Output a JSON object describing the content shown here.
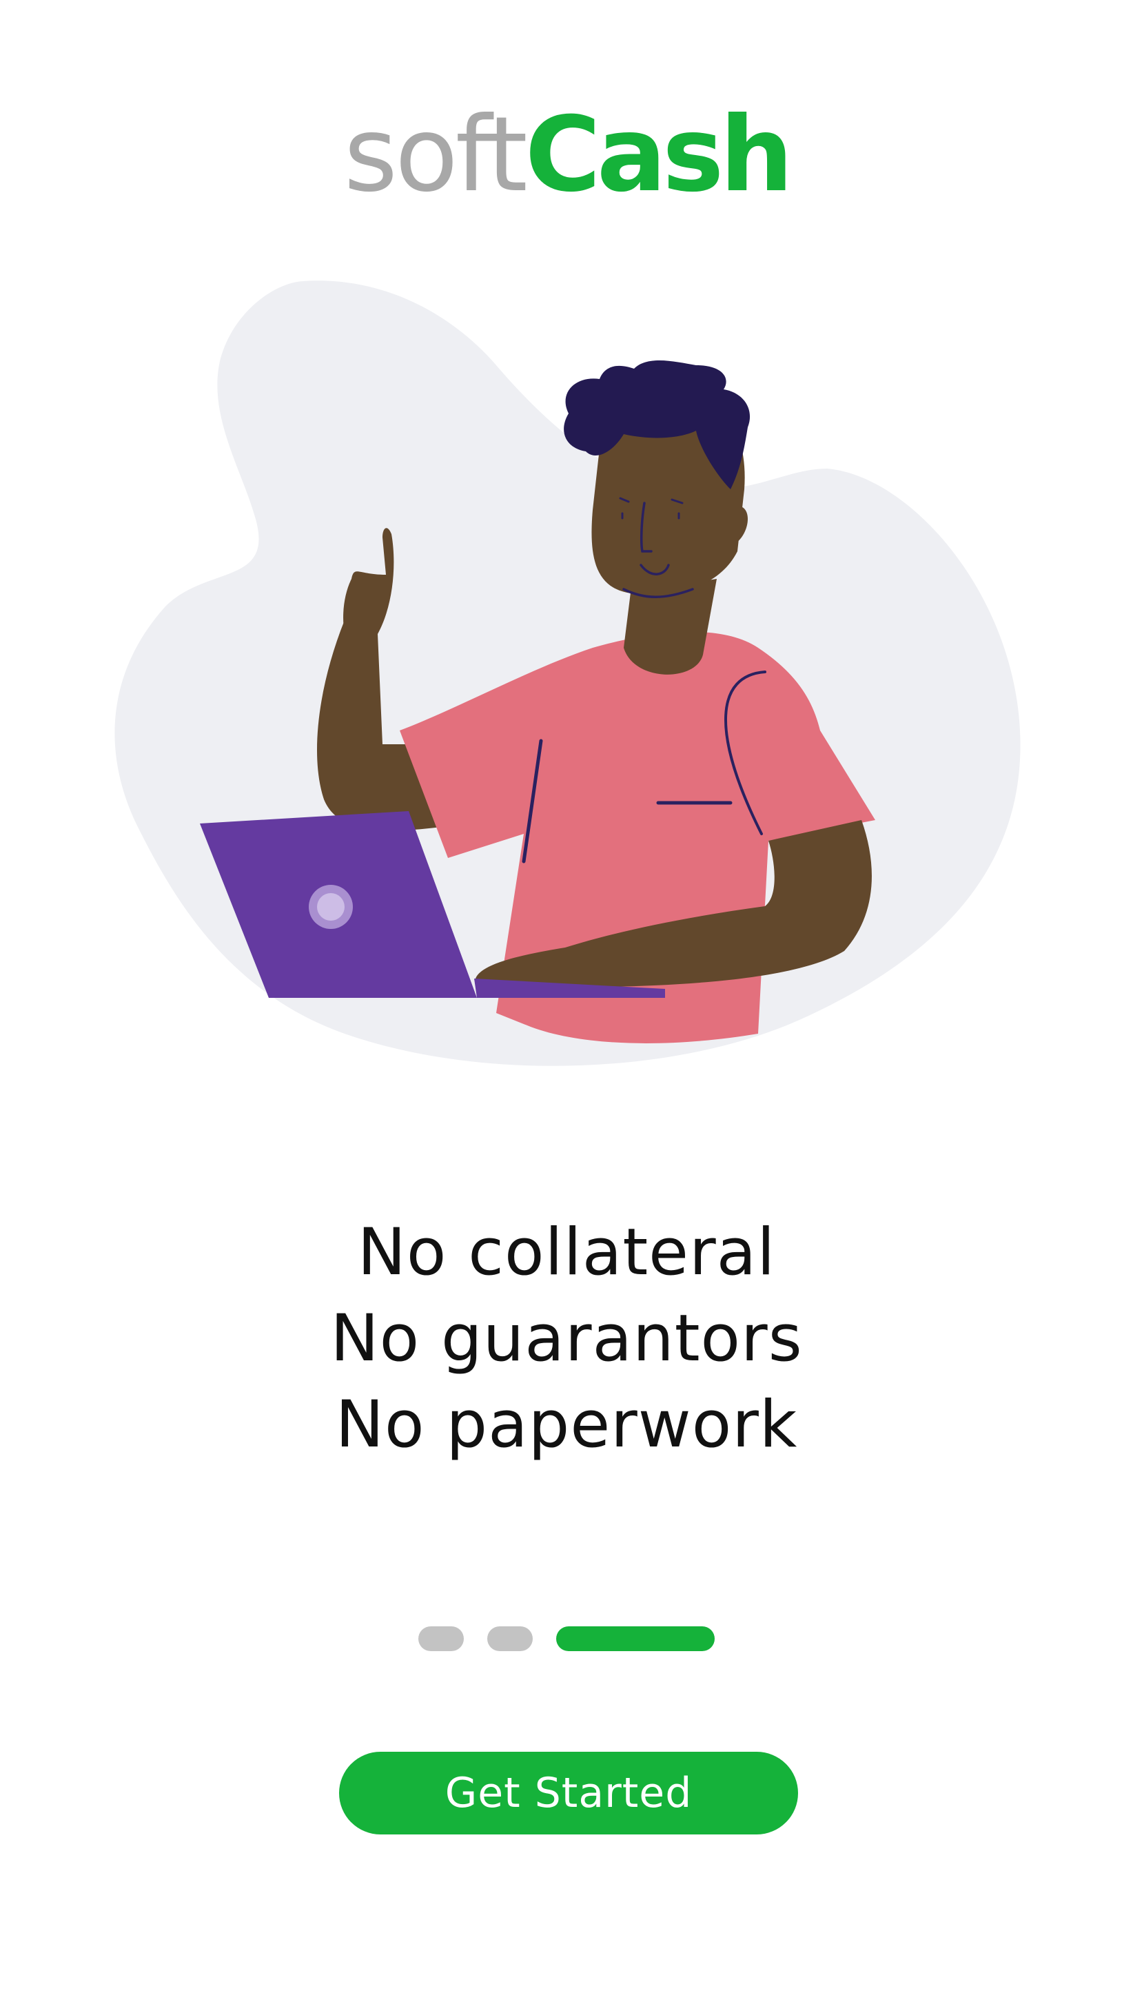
{
  "theme": {
    "accent": "#15b23a",
    "logo_soft_color": "#a8a8a8",
    "inactive_dot_color": "#c3c3c3",
    "button_text_color": "#ffffff"
  },
  "logo": {
    "part1": "soft",
    "part2": "Cash"
  },
  "illustration": {
    "subject": "person giving thumbs up at laptop"
  },
  "tagline": {
    "lines": [
      "No collateral",
      "No guarantors",
      "No paperwork"
    ]
  },
  "pager": {
    "total": 3,
    "active_index": 2
  },
  "cta": {
    "label": "Get Started"
  }
}
